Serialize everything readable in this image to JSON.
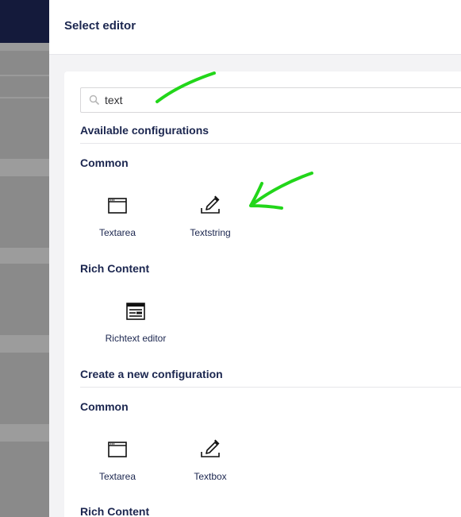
{
  "panel": {
    "title": "Select editor"
  },
  "search": {
    "value": "text",
    "placeholder": ""
  },
  "sections": {
    "available": {
      "heading": "Available configurations",
      "common": {
        "heading": "Common",
        "items": [
          {
            "label": "Textarea",
            "icon": "window-icon"
          },
          {
            "label": "Textstring",
            "icon": "pen-edit-icon"
          }
        ]
      },
      "rich": {
        "heading": "Rich Content",
        "items": [
          {
            "label": "Richtext editor",
            "icon": "richtext-icon"
          }
        ]
      }
    },
    "create": {
      "heading": "Create a new configuration",
      "common": {
        "heading": "Common",
        "items": [
          {
            "label": "Textarea",
            "icon": "window-icon"
          },
          {
            "label": "Textbox",
            "icon": "pen-edit-icon"
          }
        ]
      },
      "rich": {
        "heading": "Rich Content"
      }
    }
  },
  "colors": {
    "header_bg": "#141a3b",
    "heading_text": "#1b264f",
    "annotation": "#22d61a"
  }
}
